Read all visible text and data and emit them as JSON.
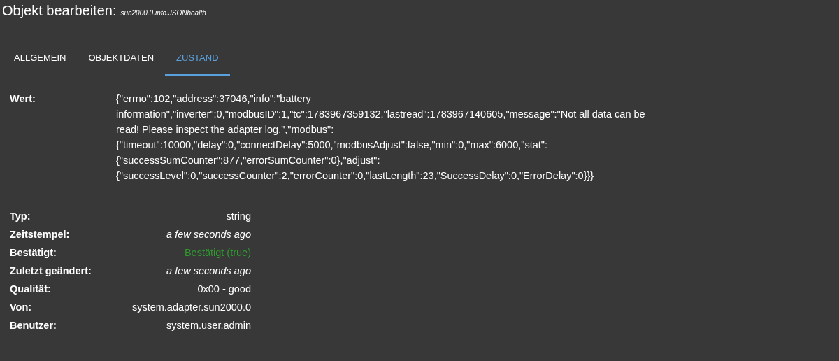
{
  "header": {
    "title": "Objekt bearbeiten:",
    "object_id": "sun2000.0.info.JSONhealth"
  },
  "tabs": [
    {
      "label": "ALLGEMEIN",
      "selected": false
    },
    {
      "label": "OBJEKTDATEN",
      "selected": false
    },
    {
      "label": "ZUSTAND",
      "selected": true
    }
  ],
  "value": {
    "label": "Wert:",
    "text": "{\"errno\":102,\"address\":37046,\"info\":\"battery information\",\"inverter\":0,\"modbusID\":1,\"tc\":1783967359132,\"lastread\":1783967140605,\"message\":\"Not all data can be read! Please inspect the adapter log.\",\"modbus\":{\"timeout\":10000,\"delay\":0,\"connectDelay\":5000,\"modbusAdjust\":false,\"min\":0,\"max\":6000,\"stat\":{\"successSumCounter\":877,\"errorSumCounter\":0},\"adjust\":{\"successLevel\":0,\"successCounter\":2,\"errorCounter\":0,\"lastLength\":23,\"SuccessDelay\":0,\"ErrorDelay\":0}}}"
  },
  "properties": [
    {
      "label": "Typ:",
      "value": "string",
      "kind": "plain"
    },
    {
      "label": "Zeitstempel:",
      "value": "a few seconds ago",
      "kind": "time"
    },
    {
      "label": "Bestätigt:",
      "value": "Bestätigt (true)",
      "kind": "ack"
    },
    {
      "label": "Zuletzt geändert:",
      "value": "a few seconds ago",
      "kind": "time"
    },
    {
      "label": "Qualität:",
      "value": "0x00 - good",
      "kind": "plain"
    },
    {
      "label": "Von:",
      "value": "system.adapter.sun2000.0",
      "kind": "plain"
    },
    {
      "label": "Benutzer:",
      "value": "system.user.admin",
      "kind": "plain"
    }
  ]
}
